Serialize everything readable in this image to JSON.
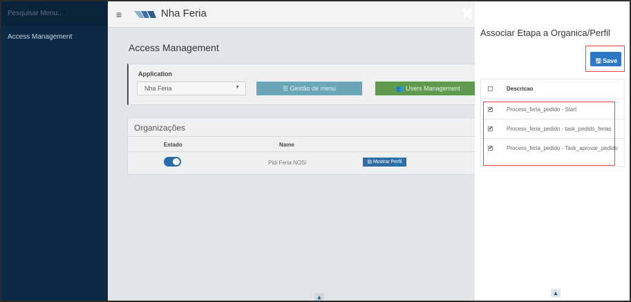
{
  "sidebar": {
    "search_placeholder": "Pesquisar Menu...",
    "items": [
      {
        "label": "Access Management"
      }
    ]
  },
  "topbar": {
    "app_title": "Nha Feria",
    "menu_icon": "hamburger-icon",
    "close_icon": "close-icon"
  },
  "main": {
    "page_title": "Access Management",
    "application": {
      "label": "Application",
      "selected": "Nha Feria",
      "gestao_button": "Gestão de menu",
      "users_button": "Users Management"
    },
    "organizations": {
      "title": "Organizações",
      "columns": [
        "Estado",
        "Name"
      ],
      "rows": [
        {
          "name": "Pidi Feria NOSi",
          "action": "Mostrar Perfil"
        }
      ]
    }
  },
  "panel": {
    "title": "Associar Etapa a Organica/Perfil",
    "save_label": "Save",
    "table": {
      "header": "Descricao",
      "rows": [
        {
          "label": "Process_feria_pedido - Start",
          "checked": true
        },
        {
          "label": "Process_feria_pedido - task_pedido_ferias",
          "checked": true
        },
        {
          "label": "Process_feria_pedido - Task_aprovar_pedido",
          "checked": true
        }
      ]
    }
  },
  "colors": {
    "sidebar": "#0c2a45",
    "accent": "#2c78c4",
    "highlight": "#e8453c"
  }
}
